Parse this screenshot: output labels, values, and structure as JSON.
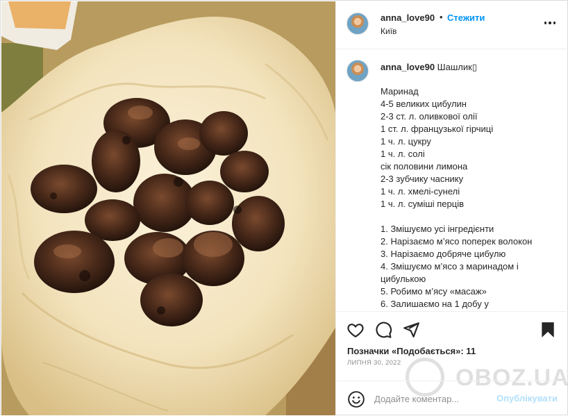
{
  "header": {
    "username": "anna_love90",
    "separator": "•",
    "follow_label": "Стежити",
    "location": "Київ"
  },
  "caption": {
    "username": "anna_love90",
    "title": "Шашлик▯",
    "lines": [
      "Маринад",
      "4-5 великих цибулин",
      "2-3 ст. л. оливкової олії",
      "1 ст. л. французької гірчиці",
      "1 ч. л. цукру",
      "1 ч. л. солі",
      "сік половини лимона",
      "2-3 зубчику часнику",
      "1 ч. л. хмелі-сунелі",
      "1 ч. л. суміші перців",
      "",
      "1. Змішуємо усі інгредієнти",
      "2. Нарізаємо м’ясо поперек волокон",
      "3. Нарізаємо добряче цибулю",
      "4. Змішуємо м’ясо з маринадом і цибулькою",
      "5. Робимо м’ясу «масаж»",
      "6. Залишаємо на 1 добу у"
    ]
  },
  "actions": {
    "like_icon": "heart-icon",
    "comment_icon": "comment-icon",
    "share_icon": "paper-plane-icon",
    "save_icon": "bookmark-icon"
  },
  "likes_text": "Позначки «Подобається»: 11",
  "date": "ЛИПНЯ 30, 2022",
  "watermark": {
    "text": "OBOZ.UA"
  },
  "comment_box": {
    "emoji_icon": "smiley-icon",
    "placeholder": "Додайте коментар...",
    "publish_label": "Опублікувати"
  },
  "colors": {
    "accent": "#0095f6",
    "publish_disabled": "#b2dffc",
    "muted": "#8e8e8e",
    "text": "#262626"
  }
}
